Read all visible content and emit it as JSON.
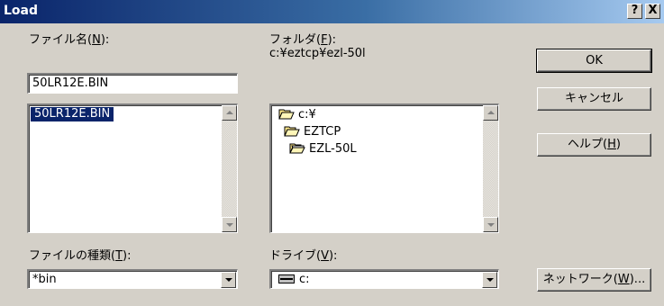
{
  "window": {
    "title": "Load",
    "help_glyph": "?",
    "close_glyph": "X"
  },
  "filename": {
    "label_pre": "ファイル名(",
    "label_key": "N",
    "label_post": "):",
    "value": "50LR12E.BIN",
    "list": [
      "50LR12E.BIN"
    ]
  },
  "folder": {
    "label_pre": "フォルダ(",
    "label_key": "F",
    "label_post": "):",
    "path": "c:¥eztcp¥ezl-50l",
    "tree": [
      {
        "name": "c:¥",
        "icon": "folder-open-icon"
      },
      {
        "name": "EZTCP",
        "icon": "folder-open-icon"
      },
      {
        "name": "EZL-50L",
        "icon": "folder-open-icon"
      }
    ]
  },
  "filetype": {
    "label_pre": "ファイルの種類(",
    "label_key": "T",
    "label_post": "):",
    "value": "*bin"
  },
  "drive": {
    "label_pre": "ドライブ(",
    "label_key": "V",
    "label_post": "):",
    "value": "c:",
    "icon": "drive-icon"
  },
  "buttons": {
    "ok": "OK",
    "cancel": "キャンセル",
    "help_pre": "ヘルプ(",
    "help_key": "H",
    "help_post": ")",
    "network_pre": "ネットワーク(",
    "network_key": "W",
    "network_post": ")..."
  },
  "colors": {
    "title_start": "#0a246a",
    "title_end": "#a6caf0",
    "face": "#d4d0c8",
    "selection": "#0a246a"
  }
}
